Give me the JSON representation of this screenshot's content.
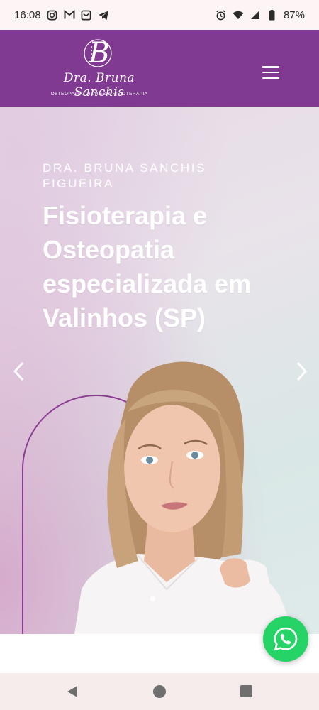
{
  "status_bar": {
    "time": "16:08",
    "battery": "87%",
    "left_icons": [
      "instagram-icon",
      "gmail-icon",
      "notification-box-icon",
      "telegram-icon"
    ],
    "right_icons": [
      "alarm-icon",
      "wifi-icon",
      "signal-icon",
      "battery-icon"
    ]
  },
  "header": {
    "logo_monogram": "B",
    "logo_name": "Dra. Bruna Sanchis",
    "logo_subtitle": "OSTEOPATIA, PILATES & FISIOTERAPIA",
    "menu_icon": "hamburger-menu-icon",
    "background_color": "#813a92"
  },
  "hero": {
    "kicker": "DRA. BRUNA SANCHIS FIGUEIRA",
    "title": "Fisioterapia e Osteopatia especializada em Valinhos (SP)",
    "prev_icon": "chevron-left-icon",
    "next_icon": "chevron-right-icon",
    "slide_count": 1,
    "active_slide": 1,
    "arch_color": "#8a3d92"
  },
  "whatsapp": {
    "icon": "whatsapp-icon",
    "color": "#25d366"
  },
  "nav_bar": {
    "back_icon": "back-triangle-icon",
    "home_icon": "home-circle-icon",
    "recents_icon": "recents-square-icon"
  }
}
